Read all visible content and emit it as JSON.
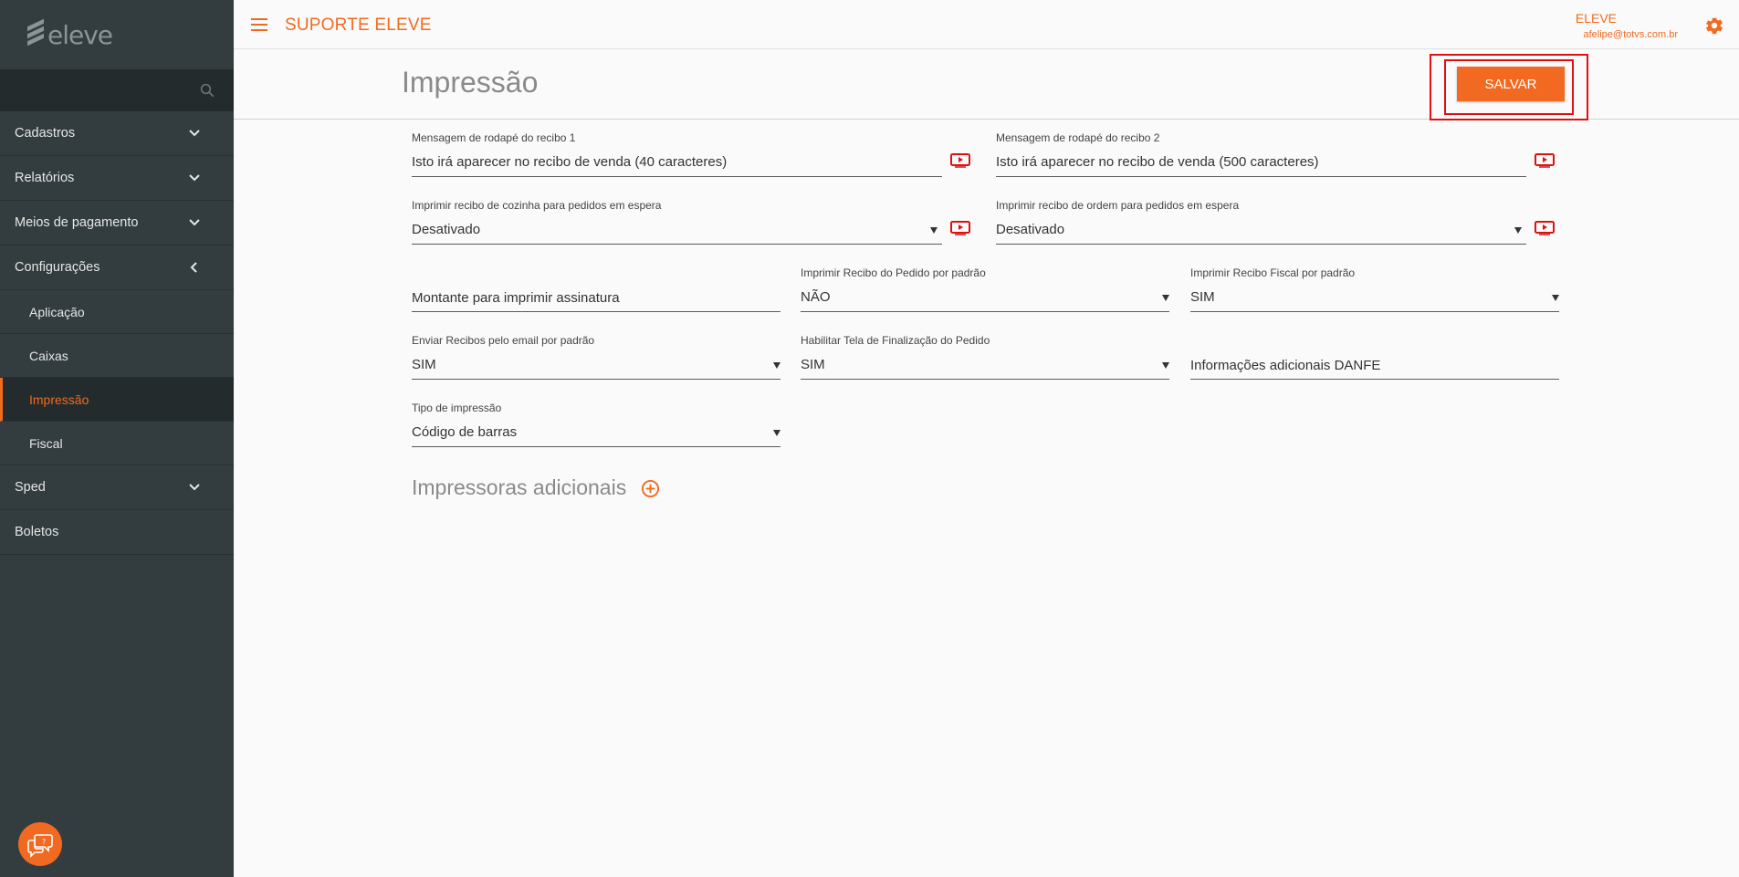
{
  "brand": {
    "logo_text": "eleve"
  },
  "header": {
    "app_title": "SUPORTE ELEVE",
    "user_name": "ELEVE",
    "user_email": "afelipe@totvs.com.br",
    "accent_color": "#f26a21"
  },
  "sidebar": {
    "search_placeholder": "",
    "items": [
      {
        "label": "Cadastros",
        "icon": "chevron-down-icon"
      },
      {
        "label": "Relatórios",
        "icon": "chevron-down-icon"
      },
      {
        "label": "Meios de pagamento",
        "icon": "chevron-down-icon"
      },
      {
        "label": "Configurações",
        "icon": "chevron-left-icon"
      },
      {
        "label": "Sped",
        "icon": "chevron-down-icon"
      },
      {
        "label": "Boletos"
      }
    ],
    "sub_items": [
      {
        "label": "Aplicação"
      },
      {
        "label": "Caixas"
      },
      {
        "label": "Impressão",
        "active": true
      },
      {
        "label": "Fiscal"
      }
    ]
  },
  "page": {
    "title": "Impressão",
    "save_label": "SALVAR",
    "additional_printers": "Impressoras adicionais"
  },
  "form": {
    "footer_msg_1": {
      "label": "Mensagem de rodapé do recibo 1",
      "value": "Isto irá aparecer no recibo de venda (40 caracteres)"
    },
    "footer_msg_2": {
      "label": "Mensagem de rodapé do recibo 2",
      "value": "Isto irá aparecer no recibo de venda (500 caracteres)"
    },
    "kitchen_receipt": {
      "label": "Imprimir recibo de cozinha para pedidos em espera",
      "value": "Desativado"
    },
    "order_receipt": {
      "label": "Imprimir recibo de ordem para pedidos em espera",
      "value": "Desativado"
    },
    "signature_amount": {
      "label": "",
      "value": "Montante para imprimir assinatura"
    },
    "order_receipt_default": {
      "label": "Imprimir Recibo do Pedido por padrão",
      "value": "NÃO"
    },
    "fiscal_receipt_default": {
      "label": "Imprimir Recibo Fiscal por padrão",
      "value": "SIM"
    },
    "email_receipts": {
      "label": "Enviar Recibos pelo email por padrão",
      "value": "SIM"
    },
    "finalization_screen": {
      "label": "Habilitar Tela de Finalização do Pedido",
      "value": "SIM"
    },
    "danfe_info": {
      "label": "",
      "value": "Informações adicionais DANFE"
    },
    "print_type": {
      "label": "Tipo de impressão",
      "value": "Código de barras"
    }
  }
}
